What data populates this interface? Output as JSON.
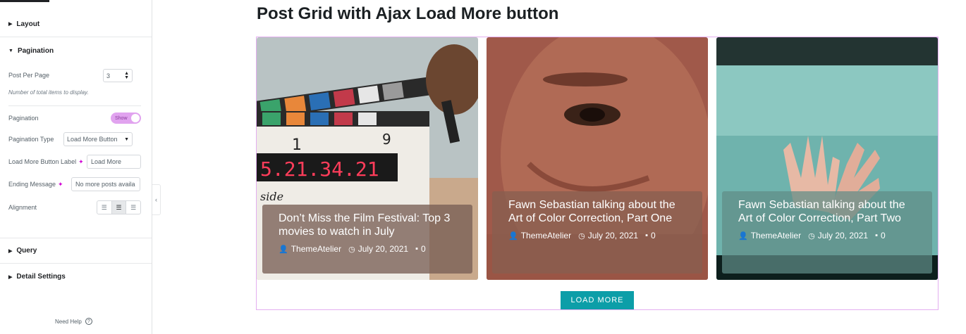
{
  "panel": {
    "sections": {
      "layout": "Layout",
      "pagination": "Pagination",
      "query": "Query",
      "detail": "Detail Settings"
    },
    "post_per_page": {
      "label": "Post Per Page",
      "value": "3",
      "hint": "Number of total items to display."
    },
    "pagination_toggle": {
      "label": "Pagination",
      "value": "Show"
    },
    "pagination_type": {
      "label": "Pagination Type",
      "value": "Load More Button"
    },
    "load_more_label": {
      "label": "Load More Button Label",
      "value": "Load More"
    },
    "ending_message": {
      "label": "Ending Message",
      "value": "No more posts availa"
    },
    "alignment": {
      "label": "Alignment",
      "selected": "center"
    },
    "help": "Need Help"
  },
  "preview": {
    "heading": "Post Grid with Ajax Load More button",
    "cards": [
      {
        "title": "Don’t Miss the Film Festival: Top 3 movies to watch in July",
        "author": "ThemeAtelier",
        "date": "July 20, 2021",
        "comments": "0"
      },
      {
        "title": "Fawn Sebastian talking about the Art of Color Correction, Part One",
        "author": "ThemeAtelier",
        "date": "July 20, 2021",
        "comments": "0"
      },
      {
        "title": "Fawn Sebastian talking about the Art of Color Correction, Part Two",
        "author": "ThemeAtelier",
        "date": "July 20, 2021",
        "comments": "0"
      }
    ],
    "load_more_button": "LOAD MORE"
  }
}
